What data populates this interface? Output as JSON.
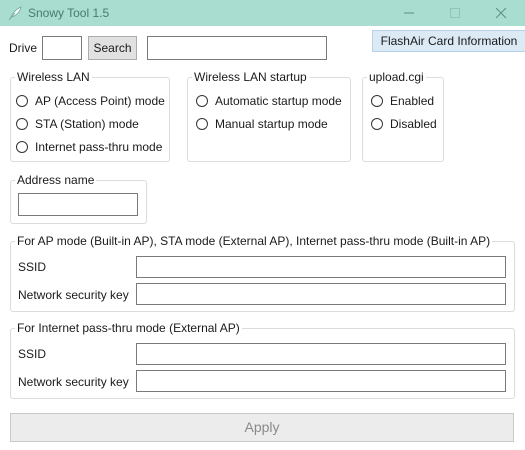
{
  "window": {
    "title": "Snowy Tool 1.5"
  },
  "toolbar": {
    "drive_label": "Drive",
    "drive_value": "",
    "search_label": "Search",
    "path_value": "",
    "info_tab_label": "FlashAir Card Information"
  },
  "wireless_lan": {
    "legend": "Wireless LAN",
    "options": [
      "AP (Access Point) mode",
      "STA (Station) mode",
      "Internet pass-thru mode"
    ]
  },
  "startup": {
    "legend": "Wireless LAN startup",
    "options": [
      "Automatic startup mode",
      "Manual startup mode"
    ]
  },
  "upload": {
    "legend": "upload.cgi",
    "options": [
      "Enabled",
      "Disabled"
    ]
  },
  "address": {
    "legend": "Address name",
    "value": ""
  },
  "builtin_ap": {
    "legend": "For AP mode (Built-in AP), STA mode (External AP), Internet pass-thru mode (Built-in AP)",
    "ssid_label": "SSID",
    "key_label": "Network security key"
  },
  "external_ap": {
    "legend": "For Internet pass-thru mode (External AP)",
    "ssid_label": "SSID",
    "key_label": "Network security key"
  },
  "apply_label": "Apply",
  "colors": {
    "titlebar": "#a8ddd0",
    "tab": "#dceaf5"
  }
}
